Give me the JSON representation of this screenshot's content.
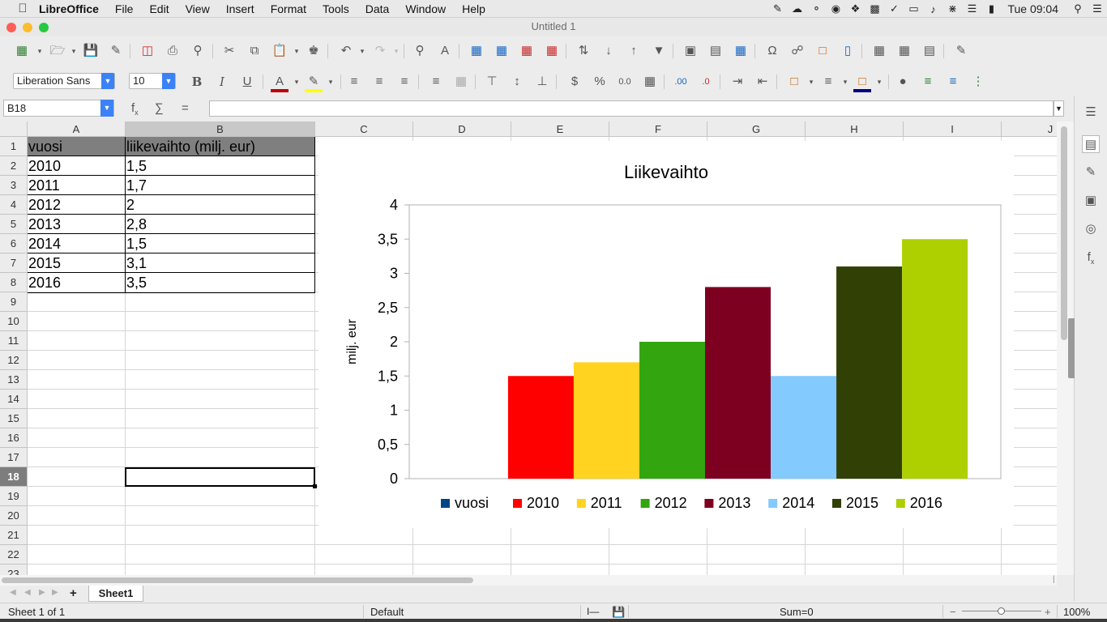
{
  "menubar": {
    "items": [
      "LibreOffice",
      "File",
      "Edit",
      "View",
      "Insert",
      "Format",
      "Tools",
      "Data",
      "Window",
      "Help"
    ],
    "clock": "Tue 09:04"
  },
  "window": {
    "title": "Untitled 1"
  },
  "toolbar": {
    "font_name": "Liberation Sans",
    "font_size": "10"
  },
  "formula_bar": {
    "name_box": "B18",
    "content": ""
  },
  "grid": {
    "columns": [
      "A",
      "B",
      "C",
      "D",
      "E",
      "F",
      "G",
      "H",
      "I",
      "J"
    ],
    "rows": [
      "1",
      "2",
      "3",
      "4",
      "5",
      "6",
      "7",
      "8",
      "9",
      "10",
      "11",
      "12",
      "13",
      "14",
      "15",
      "16",
      "17",
      "18",
      "19",
      "20",
      "21",
      "22",
      "23"
    ],
    "selected_row": "18",
    "selected_col": "B",
    "cells": [
      [
        "vuosi",
        "liikevaihto (milj. eur)"
      ],
      [
        "2010",
        "1,5"
      ],
      [
        "2011",
        "1,7"
      ],
      [
        "2012",
        "2"
      ],
      [
        "2013",
        "2,8"
      ],
      [
        "2014",
        "1,5"
      ],
      [
        "2015",
        "3,1"
      ],
      [
        "2016",
        "3,5"
      ]
    ]
  },
  "chart_data": {
    "type": "bar",
    "title": "Liikevaihto",
    "xlabel": "",
    "ylabel": "milj. eur",
    "ylim": [
      0,
      4
    ],
    "yticks": [
      "0",
      "0,5",
      "1",
      "1,5",
      "2",
      "2,5",
      "3",
      "3,5",
      "4"
    ],
    "grid": false,
    "legend_position": "bottom",
    "series": [
      {
        "name": "vuosi",
        "values": [
          null
        ],
        "color": "#004586"
      },
      {
        "name": "2010",
        "values": [
          1.5
        ],
        "color": "#ff0000"
      },
      {
        "name": "2011",
        "values": [
          1.7
        ],
        "color": "#ffd320"
      },
      {
        "name": "2012",
        "values": [
          2.0
        ],
        "color": "#33a50e"
      },
      {
        "name": "2013",
        "values": [
          2.8
        ],
        "color": "#7e0021"
      },
      {
        "name": "2014",
        "values": [
          1.5
        ],
        "color": "#83caff"
      },
      {
        "name": "2015",
        "values": [
          3.1
        ],
        "color": "#314004"
      },
      {
        "name": "2016",
        "values": [
          3.5
        ],
        "color": "#aecf00"
      }
    ]
  },
  "sheets": {
    "tabs": [
      "Sheet1"
    ]
  },
  "statusbar": {
    "sheet_info": "Sheet 1 of 1",
    "page_style": "Default",
    "sum": "Sum=0",
    "zoom": "100%"
  }
}
